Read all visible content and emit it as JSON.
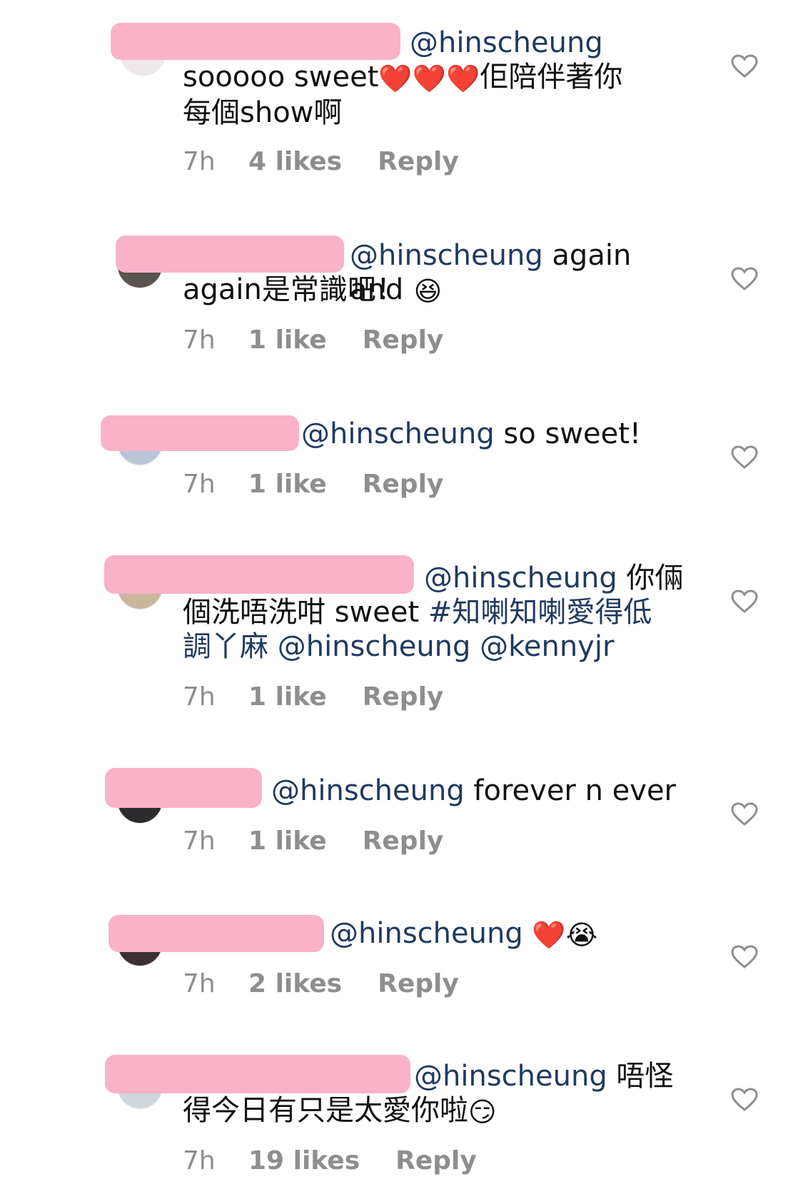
{
  "comments": [
    {
      "mention": "@hinscheung",
      "text_after": "",
      "line2": "sooooo sweet",
      "line2_emoji": "❤️❤️❤️",
      "line2_tail": "佢陪伴著你",
      "line3": "每個show啊",
      "time": "7h",
      "likes": "4 likes",
      "reply": "Reply"
    },
    {
      "mention": "@hinscheung",
      "text_after": " again and",
      "line2": "again是常識吧！",
      "line2_emoji": "😆",
      "time": "7h",
      "likes": "1 like",
      "reply": "Reply"
    },
    {
      "mention": "@hinscheung",
      "text_after": " so sweet!",
      "time": "7h",
      "likes": "1 like",
      "reply": "Reply"
    },
    {
      "mention": "@hinscheung",
      "text_after": " 你倆",
      "line2": "個洗唔洗咁 sweet ",
      "hashtag": "#知喇知喇愛得低",
      "line3_hashtag": "調丫麻",
      "line3_mentions": " @hinscheung @kennyjr",
      "time": "7h",
      "likes": "1 like",
      "reply": "Reply"
    },
    {
      "mention": "@hinscheung",
      "text_after": " forever n ever",
      "time": "7h",
      "likes": "1 like",
      "reply": "Reply"
    },
    {
      "mention": "@hinscheung",
      "emoji": "❤️😭",
      "time": "7h",
      "likes": "2 likes",
      "reply": "Reply"
    },
    {
      "mention": "@hinscheung",
      "text_after": " 唔怪",
      "line2": "得今日有只是太愛你啦",
      "line2_emoji": "😏",
      "time": "7h",
      "likes": "19 likes",
      "reply": "Reply"
    }
  ],
  "colors": {
    "mention": "#1e3a5f",
    "meta": "#8e8e8e",
    "redaction": "#f9b2c8"
  },
  "icons": {
    "like": "heart-outline-icon"
  }
}
